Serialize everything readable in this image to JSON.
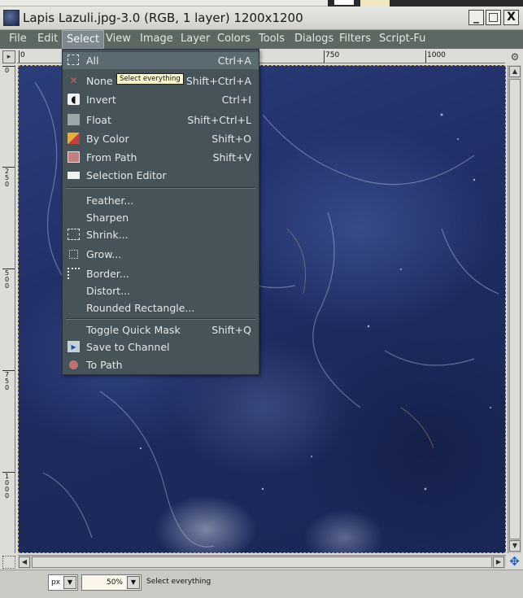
{
  "window": {
    "title": "Lapis Lazuli.jpg-3.0 (RGB, 1 layer) 1200x1200",
    "minimize_glyph": "_",
    "maximize_glyph": "□",
    "close_glyph": "X"
  },
  "menubar": [
    {
      "label": "File"
    },
    {
      "label": "Edit"
    },
    {
      "label": "Select",
      "active": true
    },
    {
      "label": "View"
    },
    {
      "label": "Image"
    },
    {
      "label": "Layer"
    },
    {
      "label": "Colors"
    },
    {
      "label": "Tools"
    },
    {
      "label": "Dialogs"
    },
    {
      "label": "Filters"
    },
    {
      "label": "Script-Fu"
    }
  ],
  "rulers": {
    "horizontal_labels": [
      "0",
      "750",
      "1000"
    ],
    "vertical_labels": [
      "0",
      "250",
      "500",
      "750",
      "1000"
    ]
  },
  "select_menu": {
    "items": [
      {
        "label": "All",
        "shortcut": "Ctrl+A",
        "icon": "select-all-icon"
      },
      {
        "label": "None",
        "shortcut": "Shift+Ctrl+A",
        "icon": "select-none-icon"
      },
      {
        "label": "Invert",
        "shortcut": "Ctrl+I",
        "icon": "invert-icon"
      },
      {
        "label": "Float",
        "shortcut": "Shift+Ctrl+L",
        "icon": "float-icon"
      },
      {
        "label": "By Color",
        "shortcut": "Shift+O",
        "icon": "by-color-icon"
      },
      {
        "label": "From Path",
        "shortcut": "Shift+V",
        "icon": "from-path-icon"
      },
      {
        "label": "Selection Editor",
        "shortcut": "",
        "icon": "selection-editor-icon"
      },
      {
        "label": "Feather...",
        "shortcut": "",
        "icon": ""
      },
      {
        "label": "Sharpen",
        "shortcut": "",
        "icon": ""
      },
      {
        "label": "Shrink...",
        "shortcut": "",
        "icon": "shrink-icon"
      },
      {
        "label": "Grow...",
        "shortcut": "",
        "icon": "grow-icon"
      },
      {
        "label": "Border...",
        "shortcut": "",
        "icon": "border-icon"
      },
      {
        "label": "Distort...",
        "shortcut": "",
        "icon": ""
      },
      {
        "label": "Rounded Rectangle...",
        "shortcut": "",
        "icon": ""
      },
      {
        "label": "Toggle Quick Mask",
        "shortcut": "Shift+Q",
        "icon": ""
      },
      {
        "label": "Save to Channel",
        "shortcut": "",
        "icon": "save-to-channel-icon"
      },
      {
        "label": "To Path",
        "shortcut": "",
        "icon": "to-path-icon"
      }
    ]
  },
  "tooltip": "Select everything",
  "statusbar": {
    "unit": "px",
    "zoom": "50%",
    "message": "Select everything"
  },
  "colors": {
    "menubar_bg": "#5d6862",
    "dropdown_bg": "#46545a",
    "highlight_bg": "#5b6b72",
    "canvas_base": "#22306a"
  }
}
